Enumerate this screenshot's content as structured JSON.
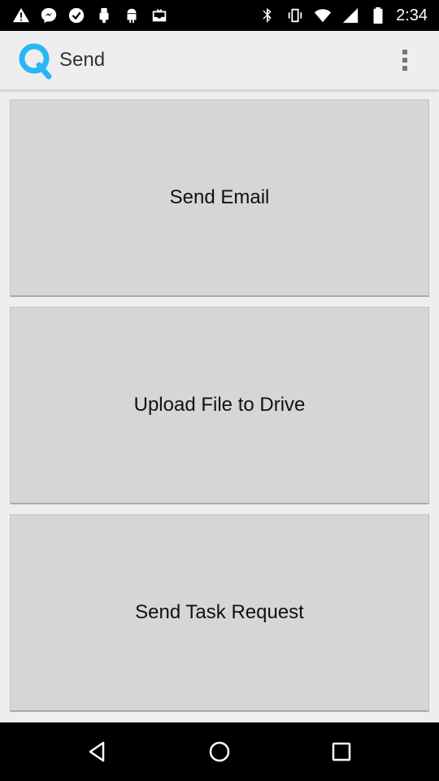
{
  "status_bar": {
    "time": "2:34",
    "notification_icons": [
      "warning-icon",
      "messenger-icon",
      "checkmark-icon",
      "usb-icon",
      "android-icon",
      "inbox-icon"
    ],
    "system_icons": [
      "bluetooth-icon",
      "vibrate-icon",
      "wifi-icon",
      "signal-icon",
      "battery-icon"
    ]
  },
  "app_bar": {
    "logo_letter": "Q",
    "title": "Send",
    "overflow_icon": "more-vert-icon",
    "brand_color": "#29b6f6"
  },
  "actions": [
    {
      "label": "Send Email"
    },
    {
      "label": "Upload File to Drive"
    },
    {
      "label": "Send Task Request"
    }
  ],
  "nav_bar": {
    "buttons": [
      "back-icon",
      "home-icon",
      "recents-icon"
    ]
  }
}
